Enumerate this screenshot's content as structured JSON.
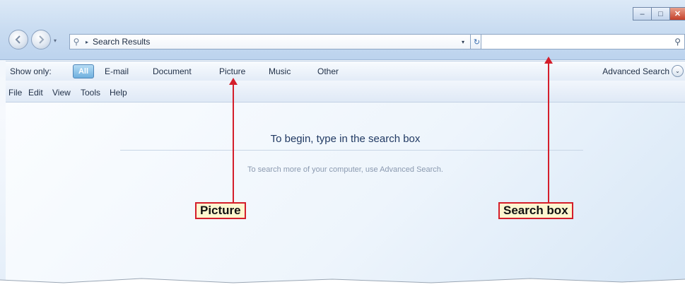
{
  "window": {
    "caption_buttons": {
      "minimize": "–",
      "maximize": "□",
      "close": "✕"
    }
  },
  "address_bar": {
    "path": "Search Results",
    "separator": "▸",
    "dropdown": "▾",
    "refresh": "↻"
  },
  "filter_bar": {
    "label": "Show only:",
    "items": [
      "All",
      "E-mail",
      "Document",
      "Picture",
      "Music",
      "Other"
    ],
    "selected": "All",
    "advanced": "Advanced Search",
    "advanced_chevron": "⌄"
  },
  "menu": {
    "items": [
      "File",
      "Edit",
      "View",
      "Tools",
      "Help"
    ]
  },
  "content": {
    "heading": "To begin, type in the search box",
    "subtext": "To search more of your computer, use Advanced Search."
  },
  "callouts": {
    "picture": "Picture",
    "search_box": "Search box"
  },
  "colors": {
    "callout_border": "#d41e2b",
    "callout_bg": "#fdf6cf"
  },
  "icons": [
    "back-icon",
    "forward-icon",
    "search-icon",
    "refresh-icon",
    "chevron-down-icon"
  ]
}
